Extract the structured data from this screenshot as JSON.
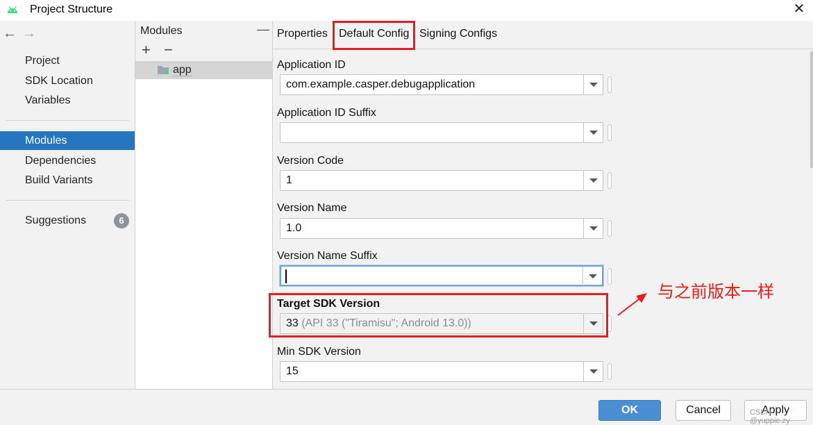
{
  "window": {
    "title": "Project Structure"
  },
  "nav": {
    "items": [
      {
        "label": "Project"
      },
      {
        "label": "SDK Location"
      },
      {
        "label": "Variables"
      },
      {
        "label": "Modules"
      },
      {
        "label": "Dependencies"
      },
      {
        "label": "Build Variants"
      },
      {
        "label": "Suggestions"
      }
    ],
    "suggestions_count": "6",
    "active": "Modules"
  },
  "modules": {
    "title": "Modules",
    "items": [
      {
        "label": "app"
      }
    ]
  },
  "tabs": [
    {
      "label": "Properties"
    },
    {
      "label": "Default Config"
    },
    {
      "label": "Signing Configs"
    }
  ],
  "active_tab": "Default Config",
  "fields": [
    {
      "label": "Application ID",
      "value": "com.example.casper.debugapplication"
    },
    {
      "label": "Application ID Suffix",
      "value": ""
    },
    {
      "label": "Version Code",
      "value": "1"
    },
    {
      "label": "Version Name",
      "value": "1.0"
    },
    {
      "label": "Version Name Suffix",
      "value": ""
    },
    {
      "label": "Target SDK Version",
      "value": "33",
      "hint": " (API 33 (\"Tiramisu\"; Android 13.0))"
    },
    {
      "label": "Min SDK Version",
      "value": "15"
    }
  ],
  "annotation": {
    "text": "与之前版本一样",
    "color": "#e81c1c"
  },
  "buttons": {
    "ok": "OK",
    "cancel": "Cancel",
    "apply": "Apply"
  },
  "watermark": "CSDN @yuppie.zy",
  "colors": {
    "accent": "#2675bf",
    "ok_button": "#4a8fd3",
    "highlight_red": "#e81c1c"
  }
}
